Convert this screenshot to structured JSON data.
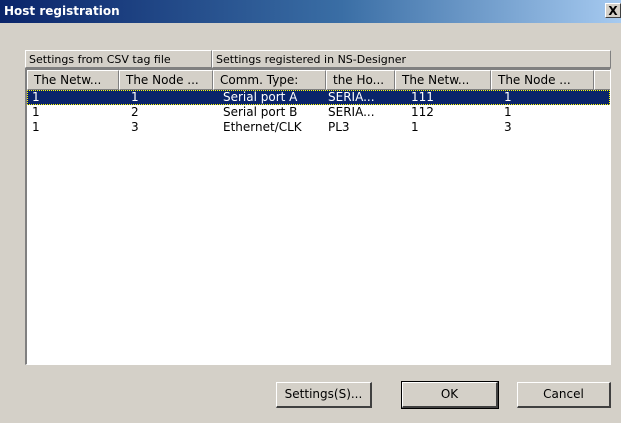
{
  "window": {
    "title": "Host registration",
    "close_label": "X"
  },
  "groups": {
    "csv": "Settings from CSV tag file",
    "ns": "Settings registered in NS-Designer"
  },
  "columns": [
    "The Netw...",
    "The Node ...",
    "Comm. Type:",
    "the Ho...",
    "The Netw...",
    "The Node ..."
  ],
  "rows": [
    [
      "1",
      "1",
      "Serial port A",
      "SERIA...",
      "111",
      "1"
    ],
    [
      "1",
      "2",
      "Serial port B",
      "SERIA...",
      "112",
      "1"
    ],
    [
      "1",
      "3",
      "Ethernet/CLK",
      "PL3",
      "1",
      "3"
    ]
  ],
  "selected_row": 0,
  "buttons": {
    "settings": "Settings(S)...",
    "ok": "OK",
    "cancel": "Cancel"
  }
}
